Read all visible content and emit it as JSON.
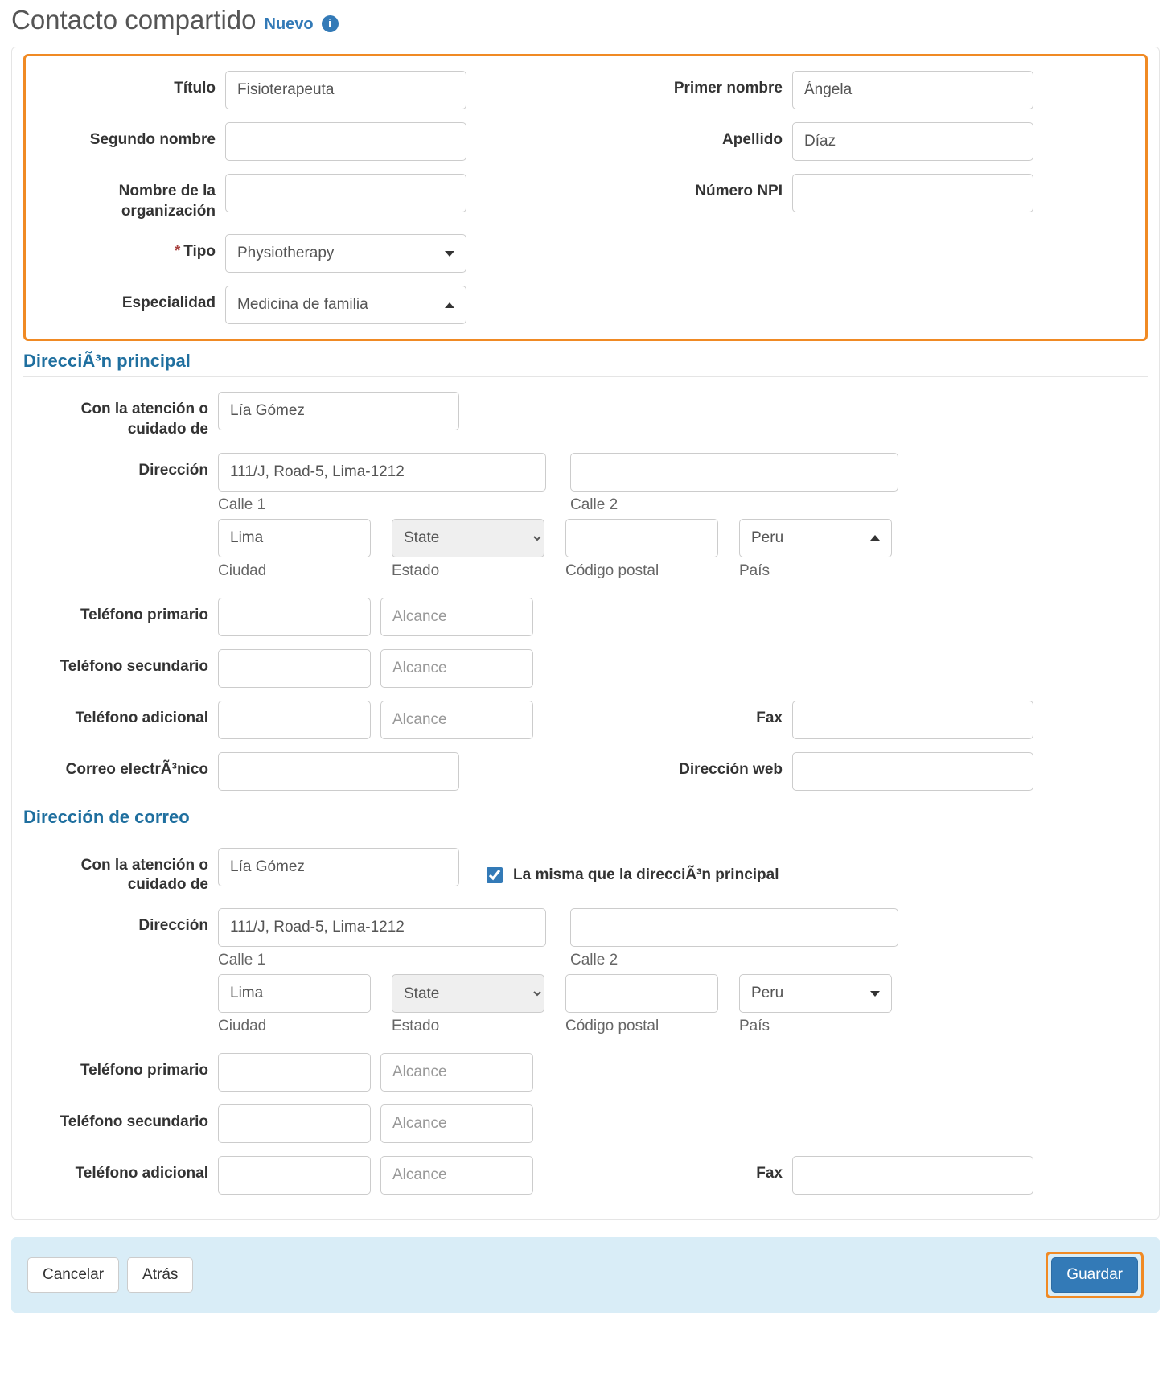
{
  "header": {
    "title": "Contacto compartido",
    "subtitle": "Nuevo",
    "info_glyph": "i"
  },
  "labels": {
    "titulo": "Título",
    "primer_nombre": "Primer nombre",
    "segundo_nombre": "Segundo nombre",
    "apellido": "Apellido",
    "org": "Nombre de la organización",
    "npi": "Número NPI",
    "tipo": "Tipo",
    "especialidad": "Especialidad",
    "required_mark": "*",
    "direccion_principal": "DirecciÃ³n principal",
    "direccion_correo": "Dirección de correo",
    "con_atencion": "Con la atención o cuidado de",
    "direccion": "Dirección",
    "calle1": "Calle 1",
    "calle2": "Calle 2",
    "ciudad": "Ciudad",
    "estado": "Estado",
    "codigo_postal": "Código postal",
    "pais": "País",
    "tel_primario": "Teléfono primario",
    "tel_secundario": "Teléfono secundario",
    "tel_adicional": "Teléfono adicional",
    "alcance_ph": "Alcance",
    "fax": "Fax",
    "correo": "Correo electrÃ³nico",
    "web": "Dirección web",
    "same_as_primary": "La misma que la direcciÃ³n principal",
    "state_option": "State"
  },
  "values": {
    "titulo": "Fisioterapeuta",
    "primer_nombre": "Ángela",
    "segundo_nombre": "",
    "apellido": "Díaz",
    "org": "",
    "npi": "",
    "tipo": "Physiotherapy",
    "especialidad": "Medicina de familia",
    "principal": {
      "care_of": "Lía Gómez",
      "calle1": "111/J, Road-5, Lima-1212",
      "calle2": "",
      "ciudad": "Lima",
      "estado": "State",
      "cp": "",
      "pais": "Peru",
      "tel1": "",
      "alc1": "",
      "tel2": "",
      "alc2": "",
      "tel3": "",
      "alc3": "",
      "fax": "",
      "email": "",
      "web": ""
    },
    "same_as_primary_checked": true,
    "correo": {
      "care_of": "Lía Gómez",
      "calle1": "111/J, Road-5, Lima-1212",
      "calle2": "",
      "ciudad": "Lima",
      "estado": "State",
      "cp": "",
      "pais": "Peru",
      "tel1": "",
      "alc1": "",
      "tel2": "",
      "alc2": "",
      "tel3": "",
      "alc3": "",
      "fax": ""
    }
  },
  "actions": {
    "cancelar": "Cancelar",
    "atras": "Atrás",
    "guardar": "Guardar"
  }
}
